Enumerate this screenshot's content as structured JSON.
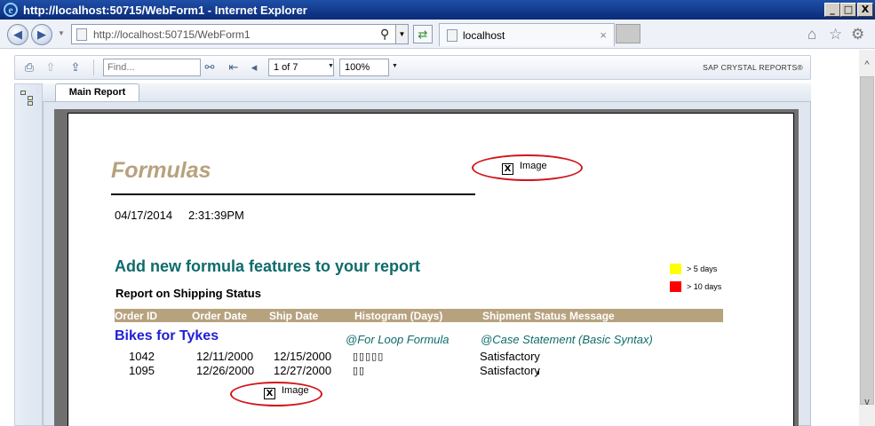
{
  "window": {
    "title": "http://localhost:50715/WebForm1 - Internet Explorer",
    "min_glyph": "_",
    "max_glyph": "□",
    "close_glyph": "X"
  },
  "browser": {
    "url": "http://localhost:50715/WebForm1",
    "back_glyph": "◀",
    "forward_glyph": "▶",
    "tab_label": "localhost",
    "tab_close_glyph": "×",
    "icons": [
      "home-icon",
      "star-icon",
      "gear-icon"
    ]
  },
  "viewer": {
    "find_placeholder": "Find...",
    "page_indicator": "1 of 7",
    "zoom": "100%",
    "brand": "SAP CRYSTAL REPORTS®",
    "tab_label": "Main Report",
    "icons": [
      "print-icon",
      "export-icon",
      "parent-report-icon",
      "find-binoculars-icon",
      "first-page-icon",
      "previous-page-icon",
      "group-tree-icon"
    ]
  },
  "report": {
    "title": "Formulas",
    "date": "04/17/2014",
    "time": "2:31:39PM",
    "heading": "Add new formula features to your report",
    "subheading": "Report on Shipping Status",
    "image_placeholder_label": "Image",
    "image_placeholder_glyph": "X",
    "legend": [
      {
        "label": "> 5 days",
        "color": "#ffff00"
      },
      {
        "label": "> 10 days",
        "color": "#ff0000"
      }
    ],
    "columns": [
      "Order ID",
      "Order Date",
      "Ship Date",
      "Histogram (Days)",
      "Shipment Status Message"
    ],
    "group_name": "Bikes for Tykes",
    "formula_loop": "@For Loop Formula",
    "formula_case": "@Case Statement (Basic Syntax)",
    "rows": [
      {
        "order_id": "1042",
        "order_date": "12/11/2000",
        "ship_date": "12/15/2000",
        "histogram": "▯▯▯▯▯",
        "status": "Satisfactory"
      },
      {
        "order_id": "1095",
        "order_date": "12/26/2000",
        "ship_date": "12/27/2000",
        "histogram": "▯▯",
        "status": "Satisfactory"
      }
    ],
    "accent_colors": {
      "title": "#b7a27e",
      "heading": "#0f6b6b",
      "group": "#1f1fd6",
      "callout": "#d0151a"
    }
  }
}
